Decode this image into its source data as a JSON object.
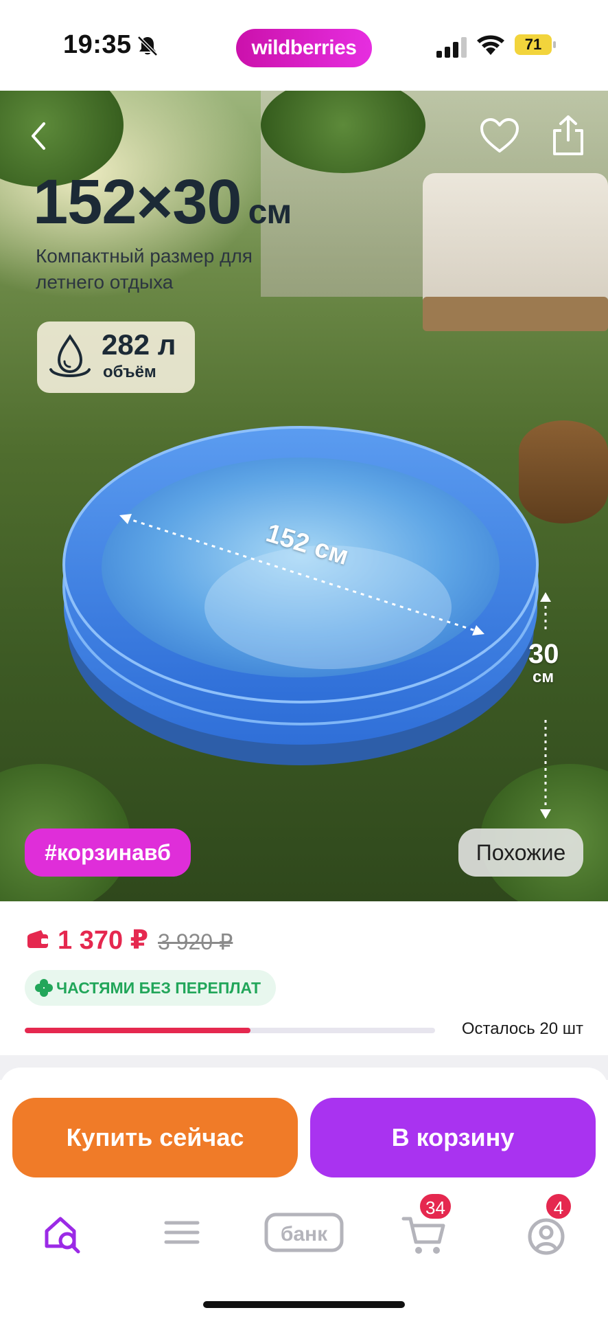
{
  "status_bar": {
    "time": "19:35",
    "brand": "wildberries",
    "battery": "71",
    "icons": [
      "bell-off-icon",
      "signal-icon",
      "wifi-icon",
      "battery-icon"
    ]
  },
  "hero": {
    "title_number": "152×30",
    "title_unit": "см",
    "subtitle": "Компактный размер для летнего отдыха",
    "volume_value": "282 л",
    "volume_label": "объём",
    "diameter_label": "152 см",
    "height_value": "30",
    "height_unit": "см",
    "tag": "#корзинавб",
    "similar": "Похожие",
    "icons": [
      "chevron-left-icon",
      "heart-icon",
      "share-icon",
      "water-drop-icon"
    ]
  },
  "price": {
    "current": "1 370 ₽",
    "old": "3 920 ₽",
    "installment": "ЧАСТЯМИ БЕЗ ПЕРЕПЛАТ",
    "stock_text": "Осталось 20 шт",
    "stock_fraction": 0.55,
    "colors": {
      "price": "#e5284f",
      "installment": "#22a65a"
    }
  },
  "actions": {
    "buy_now": "Купить сейчас",
    "add_to_cart": "В корзину",
    "colors": {
      "buy_now": "#f07b28",
      "add_to_cart": "#a933f0"
    }
  },
  "tabbar": {
    "bank_label": "банк",
    "cart_badge": "34",
    "profile_badge": "4",
    "icons": [
      "home-search-icon",
      "menu-icon",
      "bank-icon",
      "cart-icon",
      "profile-icon"
    ]
  }
}
